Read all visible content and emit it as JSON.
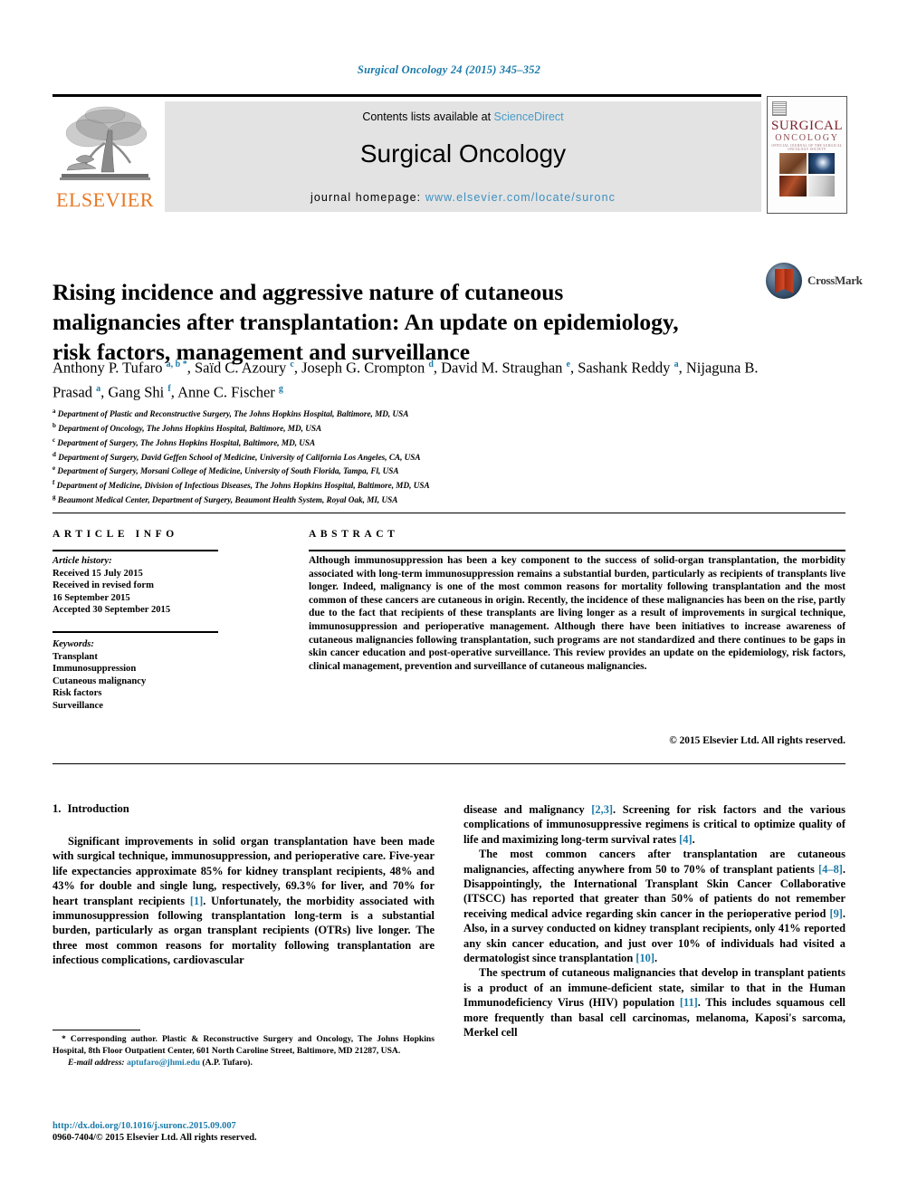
{
  "running_head": "Surgical Oncology 24 (2015) 345–352",
  "masthead": {
    "publisher": "ELSEVIER",
    "contents_prefix": "Contents lists available at ",
    "contents_link": "ScienceDirect",
    "journal_name": "Surgical Oncology",
    "homepage_prefix": "journal homepage: ",
    "homepage_url": "www.elsevier.com/locate/suronc",
    "cover": {
      "title_line1": "SURGICAL",
      "title_line2": "ONCOLOGY",
      "subtitle": "OFFICIAL JOURNAL OF THE SURGICAL ONCOLOGY SOCIETY"
    }
  },
  "crossmark": {
    "label": "CrossMark"
  },
  "article": {
    "title": "Rising incidence and aggressive nature of cutaneous malignancies after transplantation: An update on epidemiology, risk factors, management and surveillance",
    "authors": [
      {
        "name": "Anthony P. Tufaro",
        "sups": "a, b",
        "star": "*",
        "sep": ", "
      },
      {
        "name": "Saïd C. Azoury",
        "sups": "c",
        "star": "",
        "sep": ", "
      },
      {
        "name": "Joseph G. Crompton",
        "sups": "d",
        "star": "",
        "sep": ", "
      },
      {
        "name": "David M. Straughan",
        "sups": "e",
        "star": "",
        "sep": ", "
      },
      {
        "name": "Sashank Reddy",
        "sups": "a",
        "star": "",
        "sep": ", "
      },
      {
        "name": "Nijaguna B. Prasad",
        "sups": "a",
        "star": "",
        "sep": ", "
      },
      {
        "name": "Gang Shi",
        "sups": "f",
        "star": "",
        "sep": ", "
      },
      {
        "name": "Anne C. Fischer",
        "sups": "g",
        "star": "",
        "sep": ""
      }
    ],
    "affiliations": [
      {
        "marker": "a",
        "text": "Department of Plastic and Reconstructive Surgery, The Johns Hopkins Hospital, Baltimore, MD, USA"
      },
      {
        "marker": "b",
        "text": "Department of Oncology, The Johns Hopkins Hospital, Baltimore, MD, USA"
      },
      {
        "marker": "c",
        "text": "Department of Surgery, The Johns Hopkins Hospital, Baltimore, MD, USA"
      },
      {
        "marker": "d",
        "text": "Department of Surgery, David Geffen School of Medicine, University of California Los Angeles, CA, USA"
      },
      {
        "marker": "e",
        "text": "Department of Surgery, Morsani College of Medicine, University of South Florida, Tampa, Fl, USA"
      },
      {
        "marker": "f",
        "text": "Department of Medicine, Division of Infectious Diseases, The Johns Hopkins Hospital, Baltimore, MD, USA"
      },
      {
        "marker": "g",
        "text": "Beaumont Medical Center, Department of Surgery, Beaumont Health System, Royal Oak, MI, USA"
      }
    ]
  },
  "article_info": {
    "heading": "ARTICLE INFO",
    "history_label": "Article history:",
    "history_lines": [
      "Received 15 July 2015",
      "Received in revised form",
      "16 September 2015",
      "Accepted 30 September 2015"
    ],
    "keywords_label": "Keywords:",
    "keywords": [
      "Transplant",
      "Immunosuppression",
      "Cutaneous malignancy",
      "Risk factors",
      "Surveillance"
    ]
  },
  "abstract": {
    "heading": "ABSTRACT",
    "text": "Although immunosuppression has been a key component to the success of solid-organ transplantation, the morbidity associated with long-term immunosuppression remains a substantial burden, particularly as recipients of transplants live longer. Indeed, malignancy is one of the most common reasons for mortality following transplantation and the most common of these cancers are cutaneous in origin. Recently, the incidence of these malignancies has been on the rise, partly due to the fact that recipients of these transplants are living longer as a result of improvements in surgical technique, immunosuppression and perioperative management. Although there have been initiatives to increase awareness of cutaneous malignancies following transplantation, such programs are not standardized and there continues to be gaps in skin cancer education and post-operative surveillance. This review provides an update on the epidemiology, risk factors, clinical management, prevention and surveillance of cutaneous malignancies.",
    "copyright": "© 2015 Elsevier Ltd. All rights reserved."
  },
  "body": {
    "section_number": "1.",
    "section_title": "Introduction",
    "left_para_1_a": "Significant improvements in solid organ transplantation have been made with surgical technique, immunosuppression, and perioperative care. Five-year life expectancies approximate 85% for kidney transplant recipients, 48% and 43% for double and single lung, respectively, 69.3% for liver, and 70% for heart transplant recipients ",
    "left_para_1_ref1": "[1]",
    "left_para_1_b": ". Unfortunately, the morbidity associated with immunosuppression following transplantation long-term is a substantial burden, particularly as organ transplant recipients (OTRs) live longer. The three most common reasons for mortality following transplantation are infectious complications, cardiovascular",
    "right_para_1_a": "disease and malignancy ",
    "right_para_1_ref1": "[2,3]",
    "right_para_1_b": ". Screening for risk factors and the various complications of immunosuppressive regimens is critical to optimize quality of life and maximizing long-term survival rates ",
    "right_para_1_ref2": "[4]",
    "right_para_1_c": ".",
    "right_para_2_a": "The most common cancers after transplantation are cutaneous malignancies, affecting anywhere from 50 to 70% of transplant patients ",
    "right_para_2_ref1": "[4–8]",
    "right_para_2_b": ". Disappointingly, the International Transplant Skin Cancer Collaborative (ITSCC) has reported that greater than 50% of patients do not remember receiving medical advice regarding skin cancer in the perioperative period ",
    "right_para_2_ref2": "[9]",
    "right_para_2_c": ". Also, in a survey conducted on kidney transplant recipients, only 41% reported any skin cancer education, and just over 10% of individuals had visited a dermatologist since transplantation ",
    "right_para_2_ref3": "[10]",
    "right_para_2_d": ".",
    "right_para_3_a": "The spectrum of cutaneous malignancies that develop in transplant patients is a product of an immune-deficient state, similar to that in the Human Immunodeficiency Virus (HIV) population ",
    "right_para_3_ref1": "[11]",
    "right_para_3_b": ". This includes squamous cell more frequently than basal cell carcinomas, melanoma, Kaposi's sarcoma, Merkel cell"
  },
  "footnote": {
    "star": "*",
    "corresponding": " Corresponding author. Plastic & Reconstructive Surgery and Oncology, The Johns Hopkins Hospital, 8th Floor Outpatient Center, 601 North Caroline Street, Baltimore, MD 21287, USA.",
    "email_label": "E-mail address:",
    "email": "aptufaro@jhmi.edu",
    "email_attrib": " (A.P. Tufaro)."
  },
  "doi": {
    "url": "http://dx.doi.org/10.1016/j.suronc.2015.09.007",
    "issn_line": "0960-7404/© 2015 Elsevier Ltd. All rights reserved."
  },
  "colors": {
    "link": "#1a7aa8",
    "elsevier_orange": "#e87722",
    "band_gray": "#e3e3e3"
  }
}
